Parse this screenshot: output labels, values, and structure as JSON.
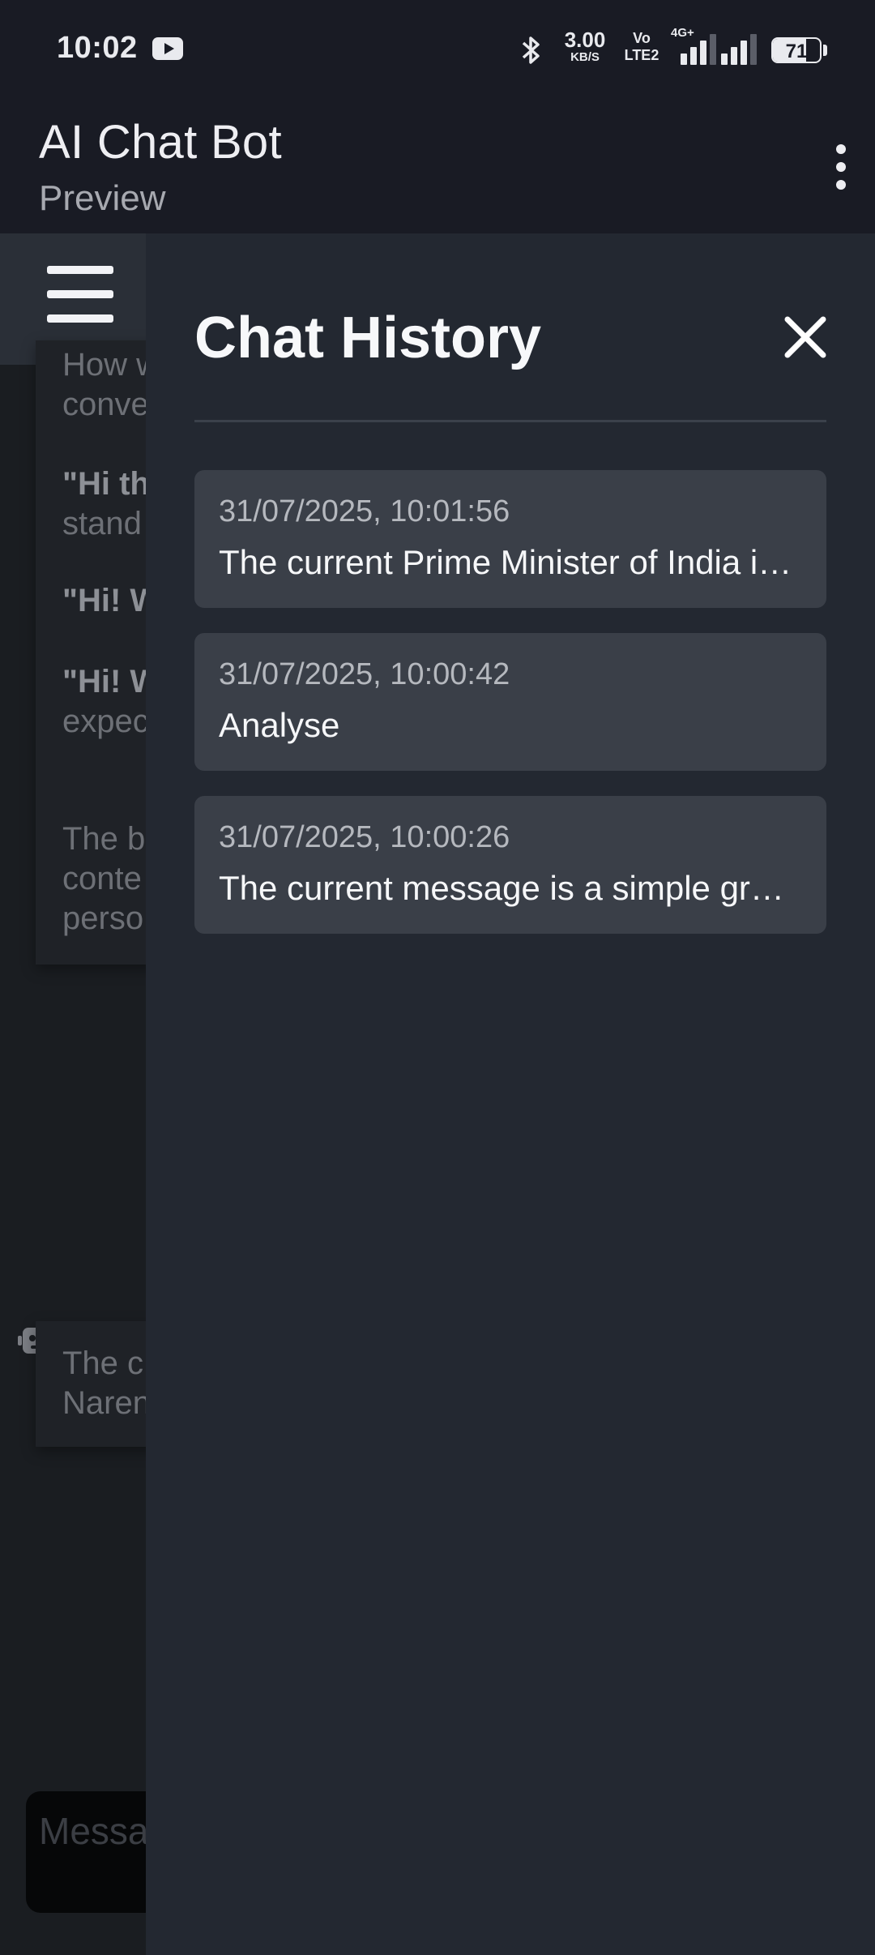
{
  "status_bar": {
    "time": "10:02",
    "net_speed_value": "3.00",
    "net_speed_unit": "KB/S",
    "volte_top": "Vo",
    "volte_bottom": "LTE2",
    "network_type": "4G+",
    "battery_percent": "71",
    "battery_level": 0.71
  },
  "app_bar": {
    "title": "AI Chat Bot",
    "subtitle": "Preview"
  },
  "chat_background": {
    "lines": [
      "How w",
      "conve",
      "\"Hi th",
      "stand",
      "\"Hi! W",
      "\"Hi!  W",
      "expec",
      "The b",
      "conte",
      "perso",
      "The c",
      "Naren"
    ],
    "input_placeholder": "Message"
  },
  "drawer": {
    "title": "Chat History",
    "items": [
      {
        "timestamp": "31/07/2025, 10:01:56",
        "preview": "The current Prime Minister of India is Narendra Modi."
      },
      {
        "timestamp": "31/07/2025, 10:00:42",
        "preview": "Analyse"
      },
      {
        "timestamp": "31/07/2025, 10:00:26",
        "preview": "The current message is a simple greeting."
      }
    ]
  },
  "colors": {
    "drawer_bg": "#232831",
    "item_bg": "#3a3f48",
    "app_bar_bg": "#191b24"
  }
}
